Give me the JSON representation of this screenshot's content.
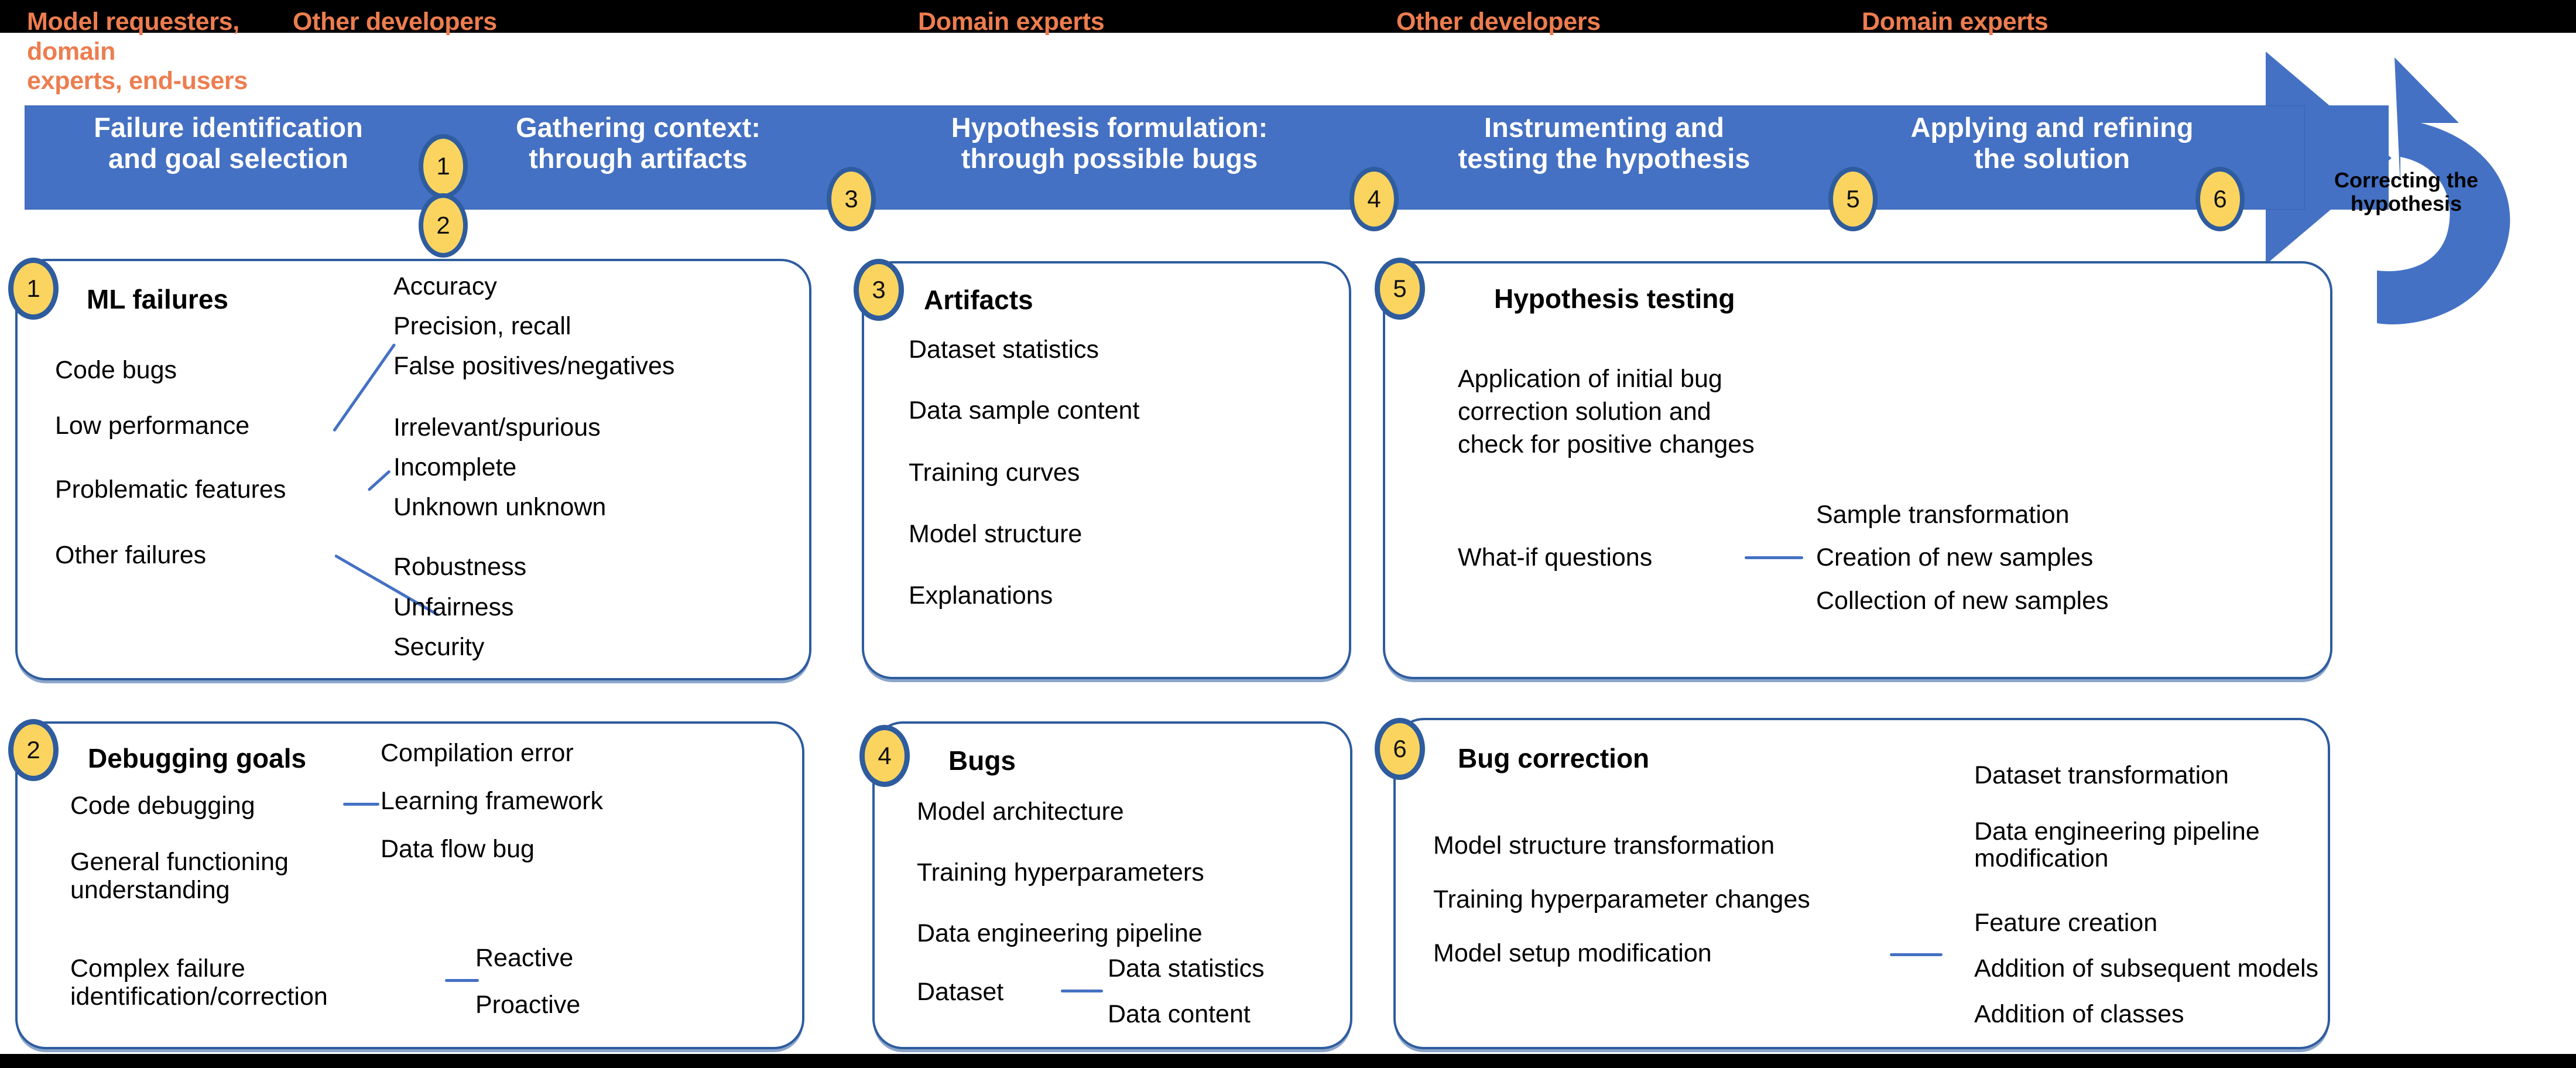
{
  "diagram": {
    "roles": [
      {
        "text": "Model requesters, domain\nexperts, end-users"
      },
      {
        "text": "Other developers"
      },
      {
        "text": "Domain experts"
      },
      {
        "text": "Other developers"
      },
      {
        "text": "Domain experts"
      }
    ],
    "process_stages": [
      {
        "number": "1",
        "label": "Failure identification\nand goal selection"
      },
      {
        "number": "3",
        "label": "Gathering context:\nthrough artifacts"
      },
      {
        "number": "4",
        "label": "Hypothesis formulation:\nthrough possible bugs"
      },
      {
        "number": "5",
        "label": "Instrumenting and\ntesting the hypothesis"
      },
      {
        "number": "6",
        "label": "Applying and refining\nthe solution"
      }
    ],
    "extra_stage_marker": "2",
    "feedback_arrow_label": "Correcting the\nhypothesis",
    "panels": {
      "ml_failures": {
        "number": "1",
        "title": "ML failures",
        "left_items": [
          "Code bugs",
          "Low performance",
          "Problematic features",
          "Other failures"
        ],
        "right_items": [
          "Accuracy",
          "Precision, recall",
          "False positives/negatives",
          "Irrelevant/spurious",
          "Incomplete",
          "Unknown unknown",
          "Robustness",
          "Unfairness",
          "Security"
        ]
      },
      "debugging_goals": {
        "number": "2",
        "title": "Debugging goals",
        "left_items": [
          "Code debugging",
          "General functioning\nunderstanding",
          "Complex failure\nidentification/correction"
        ],
        "right_group_a": [
          "Compilation error",
          "Learning framework",
          "Data flow bug"
        ],
        "right_group_b": [
          "Reactive",
          "Proactive"
        ]
      },
      "artifacts": {
        "number": "3",
        "title": "Artifacts",
        "items": [
          "Dataset statistics",
          "Data sample content",
          "Training curves",
          "Model structure",
          "Explanations"
        ]
      },
      "bugs": {
        "number": "4",
        "title": "Bugs",
        "items": [
          "Model architecture",
          "Training hyperparameters",
          "Data engineering pipeline",
          "Dataset"
        ],
        "dataset_children": [
          "Data statistics",
          "Data content"
        ]
      },
      "hypothesis_testing": {
        "number": "5",
        "title": "Hypothesis testing",
        "description": "Application of initial bug\ncorrection solution and\ncheck for positive changes",
        "left_item": "What-if questions",
        "right_items": [
          "Sample transformation",
          "Creation of new samples",
          "Collection of new samples"
        ]
      },
      "bug_correction": {
        "number": "6",
        "title": "Bug correction",
        "left_items": [
          "Model structure transformation",
          "Training hyperparameter changes",
          "Model setup modification"
        ],
        "right_items": [
          "Dataset transformation",
          "Data engineering pipeline\nmodification",
          "Feature creation",
          "Addition of subsequent models",
          "Addition of classes"
        ]
      }
    },
    "colors": {
      "ribbon_blue": "#4471C4",
      "circle_fill": "#FBD45F",
      "circle_border": "#2E5C9E",
      "role_orange": "#ED7D4F",
      "panel_border": "#2E5C9E",
      "connector_blue": "#4471C4",
      "band_black": "#000000"
    }
  }
}
